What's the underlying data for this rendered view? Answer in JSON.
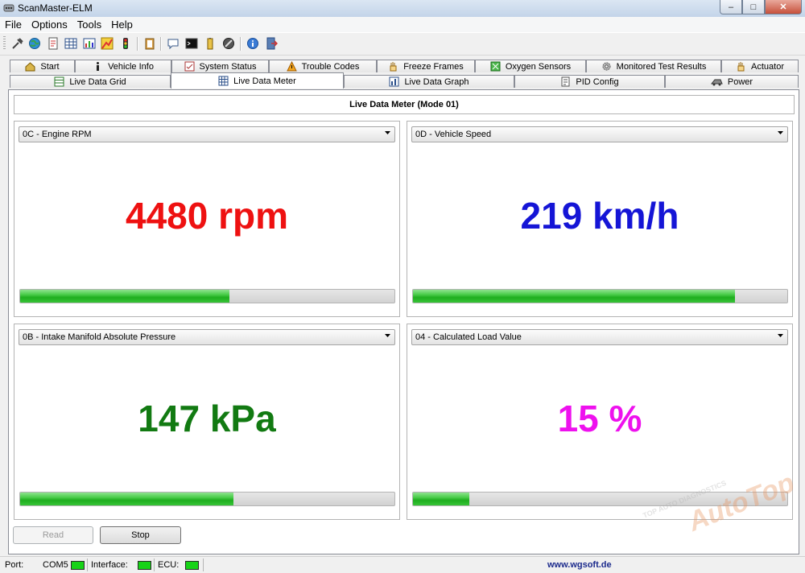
{
  "window": {
    "title": "ScanMaster-ELM",
    "minimize": "–",
    "maximize": "□",
    "close": "✕"
  },
  "menu": [
    "File",
    "Options",
    "Tools",
    "Help"
  ],
  "toolbar_icons": [
    "connect-icon",
    "globe-icon",
    "document-icon",
    "grid-icon",
    "chart-icon",
    "map-icon",
    "traffic-light-icon",
    "clipboard-icon",
    "chat-icon",
    "terminal-icon",
    "battery-icon",
    "stop-icon",
    "info-icon",
    "exit-icon"
  ],
  "tabs_row1": [
    {
      "label": "Start",
      "icon": "home-icon"
    },
    {
      "label": "Vehicle Info",
      "icon": "info-icon"
    },
    {
      "label": "System Status",
      "icon": "status-icon"
    },
    {
      "label": "Trouble Codes",
      "icon": "warning-icon"
    },
    {
      "label": "Freeze Frames",
      "icon": "hand-icon"
    },
    {
      "label": "Oxygen Sensors",
      "icon": "sensor-icon"
    },
    {
      "label": "Monitored Test Results",
      "icon": "gear-icon"
    },
    {
      "label": "Actuator",
      "icon": "hand-icon"
    }
  ],
  "tabs_row2": [
    {
      "label": "Live Data Grid",
      "icon": "grid-icon"
    },
    {
      "label": "Live Data Meter",
      "icon": "meter-icon",
      "active": true
    },
    {
      "label": "Live Data Graph",
      "icon": "graph-icon"
    },
    {
      "label": "PID Config",
      "icon": "config-icon"
    },
    {
      "label": "Power",
      "icon": "power-icon"
    }
  ],
  "meter": {
    "header": "Live Data Meter (Mode 01)",
    "panels": [
      {
        "pid": "0C - Engine RPM",
        "value": "4480 rpm",
        "color": "#ee1111",
        "level": 0.56
      },
      {
        "pid": "0D - Vehicle Speed",
        "value": "219 km/h",
        "color": "#1515d6",
        "level": 0.86
      },
      {
        "pid": "0B - Intake Manifold Absolute Pressure",
        "value": "147 kPa",
        "color": "#127a12",
        "level": 0.57
      },
      {
        "pid": "04 - Calculated Load Value",
        "value": "15 %",
        "color": "#ee11ee",
        "level": 0.15
      }
    ]
  },
  "buttons": {
    "read": "Read",
    "stop": "Stop"
  },
  "status": {
    "port_label": "Port:",
    "port_value": "COM5",
    "interface_label": "Interface:",
    "ecu_label": "ECU:",
    "website": "www.wgsoft.de",
    "led_color": "#17d317"
  },
  "watermark": {
    "brand": "AutoTop",
    "tagline": "TOP AUTO DIAGNOSTICS"
  }
}
